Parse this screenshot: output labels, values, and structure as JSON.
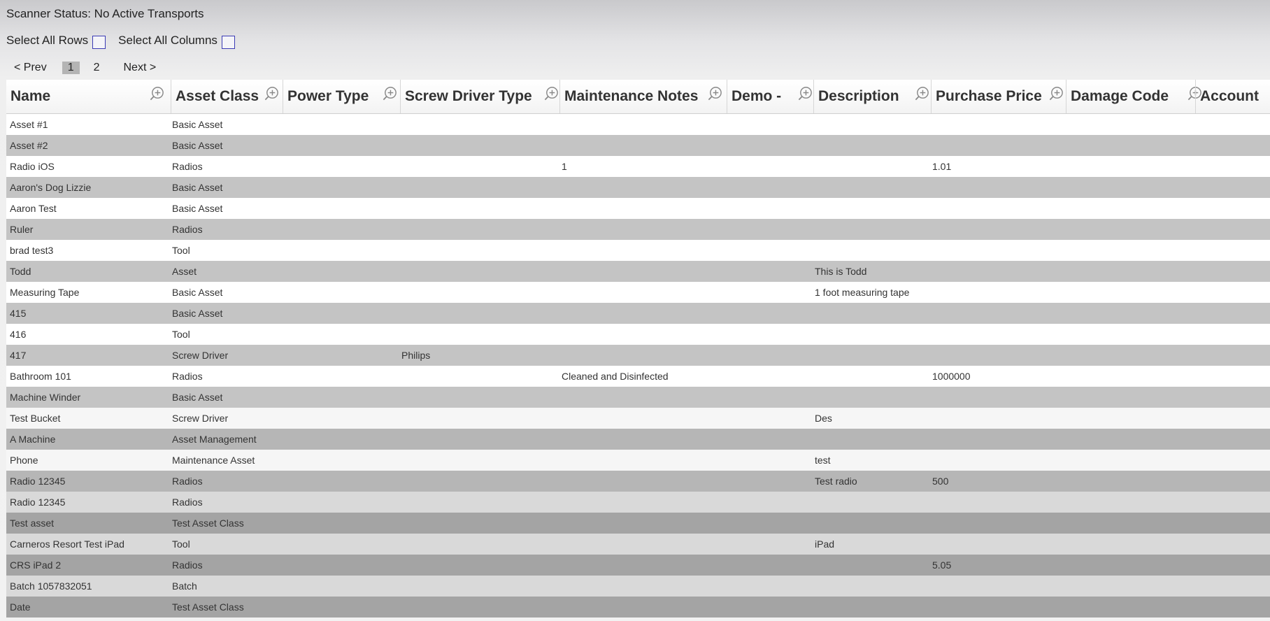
{
  "scanner_status": "Scanner Status: No Active Transports",
  "select_all_rows_label": "Select All Rows",
  "select_all_columns_label": "Select All Columns",
  "pagination": {
    "prev": "< Prev",
    "pages": [
      "1",
      "2"
    ],
    "current": "1",
    "next": "Next >"
  },
  "columns": [
    "Name",
    "Asset Class",
    "Power Type",
    "Screw Driver Type",
    "Maintenance Notes",
    "Demo -",
    "Description",
    "Purchase Price",
    "Damage Code",
    "Account"
  ],
  "rows": [
    [
      "Asset #1",
      "Basic Asset",
      "",
      "",
      "",
      "",
      "",
      "",
      "",
      ""
    ],
    [
      "Asset #2",
      "Basic Asset",
      "",
      "",
      "",
      "",
      "",
      "",
      "",
      ""
    ],
    [
      "Radio iOS",
      "Radios",
      "",
      "",
      "1",
      "",
      "",
      "1.01",
      "",
      ""
    ],
    [
      "Aaron's Dog Lizzie",
      "Basic Asset",
      "",
      "",
      "",
      "",
      "",
      "",
      "",
      ""
    ],
    [
      "Aaron Test",
      "Basic Asset",
      "",
      "",
      "",
      "",
      "",
      "",
      "",
      ""
    ],
    [
      "Ruler",
      "Radios",
      "",
      "",
      "",
      "",
      "",
      "",
      "",
      ""
    ],
    [
      "brad test3",
      "Tool",
      "",
      "",
      "",
      "",
      "",
      "",
      "",
      ""
    ],
    [
      "Todd",
      "Asset",
      "",
      "",
      "",
      "",
      "This is Todd",
      "",
      "",
      ""
    ],
    [
      "Measuring Tape",
      "Basic Asset",
      "",
      "",
      "",
      "",
      "1 foot measuring tape",
      "",
      "",
      ""
    ],
    [
      "415",
      "Basic Asset",
      "",
      "",
      "",
      "",
      "",
      "",
      "",
      ""
    ],
    [
      "416",
      "Tool",
      "",
      "",
      "",
      "",
      "",
      "",
      "",
      ""
    ],
    [
      "417",
      "Screw Driver",
      "",
      "Philips",
      "",
      "",
      "",
      "",
      "",
      ""
    ],
    [
      "Bathroom 101",
      "Radios",
      "",
      "",
      "Cleaned and Disinfected",
      "",
      "",
      "1000000",
      "",
      ""
    ],
    [
      "Machine Winder",
      "Basic Asset",
      "",
      "",
      "",
      "",
      "",
      "",
      "",
      ""
    ],
    [
      "Test Bucket",
      "Screw Driver",
      "",
      "",
      "",
      "",
      "Des",
      "",
      "",
      ""
    ],
    [
      "A Machine",
      "Asset Management",
      "",
      "",
      "",
      "",
      "",
      "",
      "",
      ""
    ],
    [
      "Phone",
      "Maintenance Asset",
      "",
      "",
      "",
      "",
      "test",
      "",
      "",
      ""
    ],
    [
      "Radio 12345",
      "Radios",
      "",
      "",
      "",
      "",
      "Test radio",
      "500",
      "",
      ""
    ],
    [
      "Radio 12345",
      "Radios",
      "",
      "",
      "",
      "",
      "",
      "",
      "",
      ""
    ],
    [
      "Test asset",
      "Test Asset Class",
      "",
      "",
      "",
      "",
      "",
      "",
      "",
      ""
    ],
    [
      "Carneros Resort Test iPad",
      "Tool",
      "",
      "",
      "",
      "",
      "iPad",
      "",
      "",
      ""
    ],
    [
      "CRS iPad 2",
      "Radios",
      "",
      "",
      "",
      "",
      "",
      "5.05",
      "",
      ""
    ],
    [
      "Batch 1057832051",
      "Batch",
      "",
      "",
      "",
      "",
      "",
      "",
      "",
      ""
    ],
    [
      "Date",
      "Test Asset Class",
      "",
      "",
      "",
      "",
      "",
      "",
      "",
      ""
    ]
  ],
  "icons": {
    "column_zoom": "zoom-in-icon",
    "checkbox": "checkbox-icon"
  },
  "colors": {
    "checkbox_border": "#3b3bb5",
    "row_dark": "#c4c4c4",
    "row_light": "#ffffff",
    "current_page_bg": "#b4b4b4"
  }
}
